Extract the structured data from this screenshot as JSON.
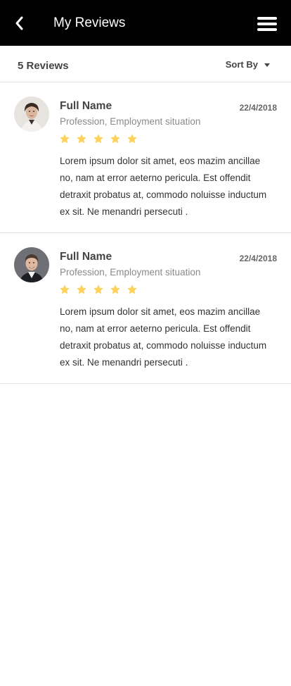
{
  "header": {
    "title": "My Reviews",
    "back_icon": "chevron-left-icon",
    "menu_icon": "hamburger-menu-icon"
  },
  "summary": {
    "count_label": "5 Reviews",
    "sort_label": "Sort By",
    "sort_icon": "caret-down-icon"
  },
  "reviews": [
    {
      "name": "Full Name",
      "date": "22/4/2018",
      "profession": "Profession, Employment situation",
      "rating": 5,
      "text": "Lorem ipsum dolor sit amet, eos mazim ancillae no, nam at error aeterno pericula. Est offendit detraxit probatus at, commodo noluisse inductum ex sit. Ne menandri persecuti ."
    },
    {
      "name": "Full Name",
      "date": "22/4/2018",
      "profession": "Profession, Employment situation",
      "rating": 5,
      "text": "Lorem ipsum dolor sit amet, eos mazim ancillae no, nam at error aeterno pericula. Est offendit detraxit probatus at, commodo noluisse inductum ex sit. Ne menandri persecuti ."
    }
  ],
  "colors": {
    "header_bg": "#000000",
    "star": "#fdd15a",
    "divider": "#e2e2e2"
  }
}
